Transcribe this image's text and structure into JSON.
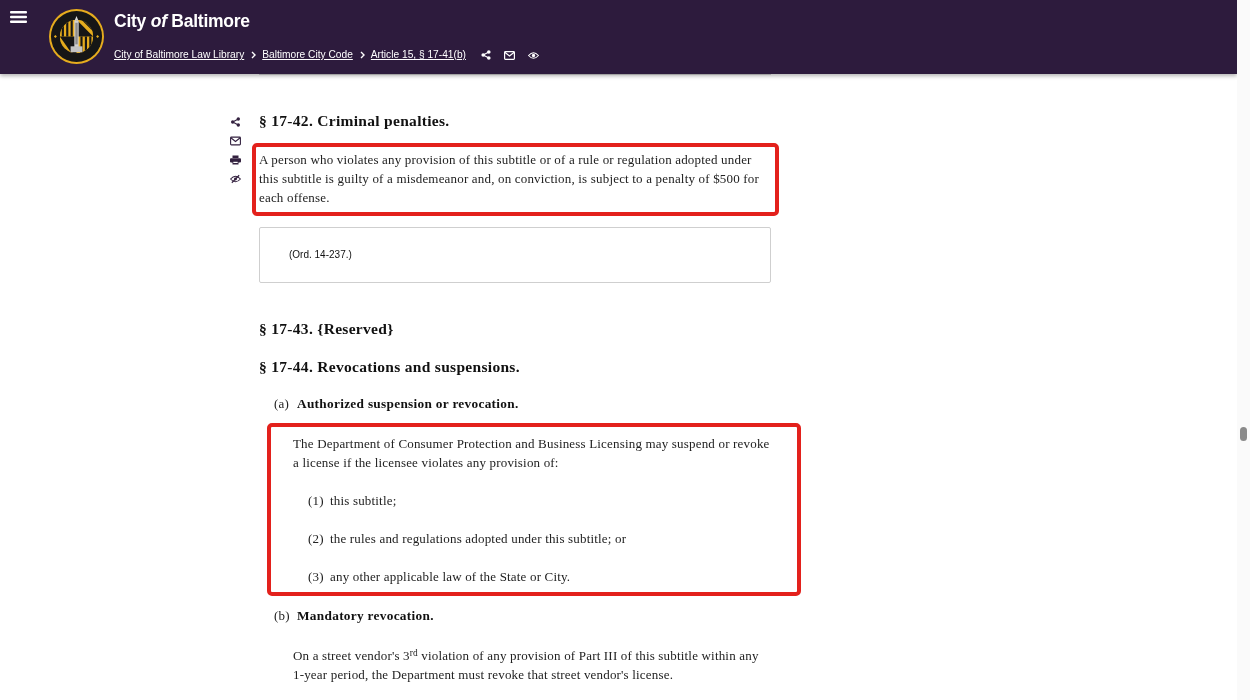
{
  "header": {
    "title": "City *of* Baltimore",
    "breadcrumbs": [
      {
        "label": "City of Baltimore Law Library"
      },
      {
        "label": "Baltimore City Code"
      },
      {
        "label": "Article 15, § 17-41(b)"
      }
    ]
  },
  "content": [
    {
      "kind": "heading",
      "text": "§ 17-42. Criminal penalties.",
      "tools_visible": true
    },
    {
      "kind": "paragraph",
      "highlighted": true,
      "text": "A person who violates any provision of this subtitle or of a rule or regulation adopted under this subtitle is guilty of a misdemeanor and, on conviction, is subject to a penalty of $500 for each offense."
    },
    {
      "kind": "history_note",
      "text": "(Ord. 14-237.)"
    },
    {
      "kind": "heading",
      "text": "§ 17-43. {Reserved}",
      "tools_visible": false
    },
    {
      "kind": "heading",
      "text": "§ 17-44. Revocations and suspensions.",
      "tools_visible": false
    },
    {
      "kind": "subsection",
      "label": "(a)",
      "title": "Authorized suspension or revocation.",
      "highlighted": true,
      "text": "The Department of Consumer Protection and Business Licensing may suspend or revoke a license if the licensee violates any provision of:",
      "items": [
        {
          "label": "(1)",
          "text": "this subtitle;"
        },
        {
          "label": "(2)",
          "text": "the rules and regulations adopted under this subtitle; or"
        },
        {
          "label": "(3)",
          "text": "any other applicable law of the State or City."
        }
      ]
    },
    {
      "kind": "subsection",
      "label": "(b)",
      "title": "Mandatory revocation.",
      "highlighted": false,
      "text": "On a street vendor's 3$^{rd}$ violation of any provision of Part III of this subtitle within any 1-year period, the Department must revoke that street vendor's license."
    }
  ]
}
